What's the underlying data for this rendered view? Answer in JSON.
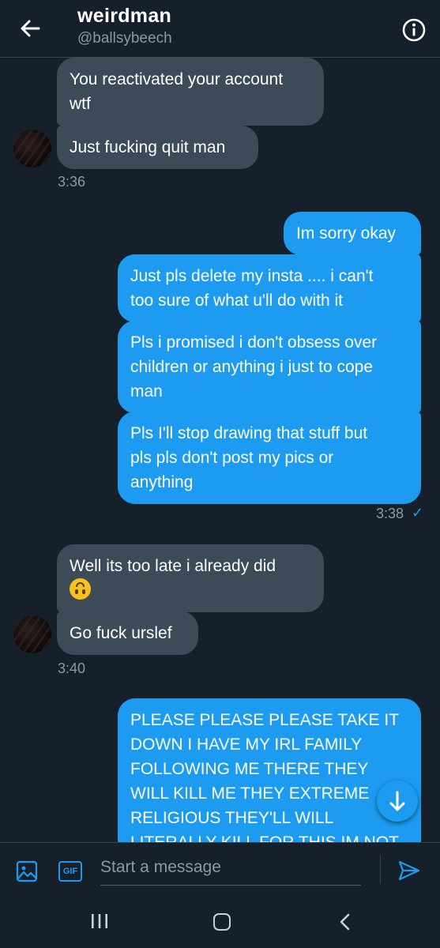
{
  "header": {
    "title": "weirdman",
    "handle": "@ballsybeech"
  },
  "messages": [
    {
      "dir": "in",
      "lines": [
        "You reactivated your account",
        "wtf"
      ]
    },
    {
      "dir": "in",
      "lines": [
        "Just fucking quit man"
      ]
    },
    {
      "dir": "in",
      "time": "3:36"
    },
    {
      "dir": "out",
      "lines": [
        "Im sorry okay"
      ]
    },
    {
      "dir": "out",
      "lines": [
        "Just pls delete my insta .... i can't",
        "too sure of what u'll do with it"
      ]
    },
    {
      "dir": "out",
      "lines": [
        "Pls i promised i don't obsess over",
        "children or anything i just to cope",
        "man"
      ]
    },
    {
      "dir": "out",
      "lines": [
        "Pls I'll stop drawing that stuff but",
        "pls pls don't post my pics or",
        "anything"
      ]
    },
    {
      "dir": "out",
      "time": "3:38",
      "status": "✓"
    },
    {
      "dir": "in",
      "lines": [
        "Well its too late i already did"
      ]
    },
    {
      "dir": "in",
      "lines": [
        "Go fuck urslef"
      ]
    },
    {
      "dir": "in",
      "time": "3:40"
    },
    {
      "dir": "out",
      "lines": [
        "PLEASE PLEASE PLEASE TAKE IT",
        "DOWN I HAVE MY IRL FAMILY",
        "FOLLOWING ME THERE THEY",
        "WILL KILL ME THEY EXTREME",
        "RELIGIOUS THEY'LL WILL",
        "LITERALLY KILL FOR THIS IM NOT"
      ]
    }
  ],
  "composer": {
    "placeholder": "Start a message",
    "gif_label": "GIF"
  },
  "icons": {
    "back": "arrow-left-icon",
    "info": "info-icon",
    "media": "image-icon",
    "gif": "gif-icon",
    "send": "send-icon",
    "scroll": "arrow-down-icon",
    "emoji": "upside-down-face-emoji"
  },
  "colors": {
    "background": "#15202b",
    "accent": "#1d9bf0",
    "incoming": "#3d4b58",
    "muted": "#8899a6"
  }
}
